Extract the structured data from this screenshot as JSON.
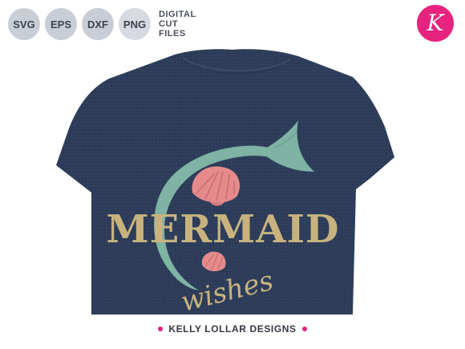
{
  "formats": [
    "SVG",
    "EPS",
    "DXF",
    "PNG"
  ],
  "digital_cut_files": [
    "DIGITAL",
    "CUT",
    "FILES"
  ],
  "logo": {
    "letter": "K",
    "color": "#e6237e"
  },
  "design": {
    "word_main": "MERMAID",
    "word_script": "wishes",
    "shirt_color": "#2b3a56",
    "tail_color": "#7fb3a4",
    "text_color": "#c8b37e",
    "shell_color": "#e58b8b"
  },
  "footer": {
    "brand": "KELLY LOLLAR DESIGNS"
  }
}
